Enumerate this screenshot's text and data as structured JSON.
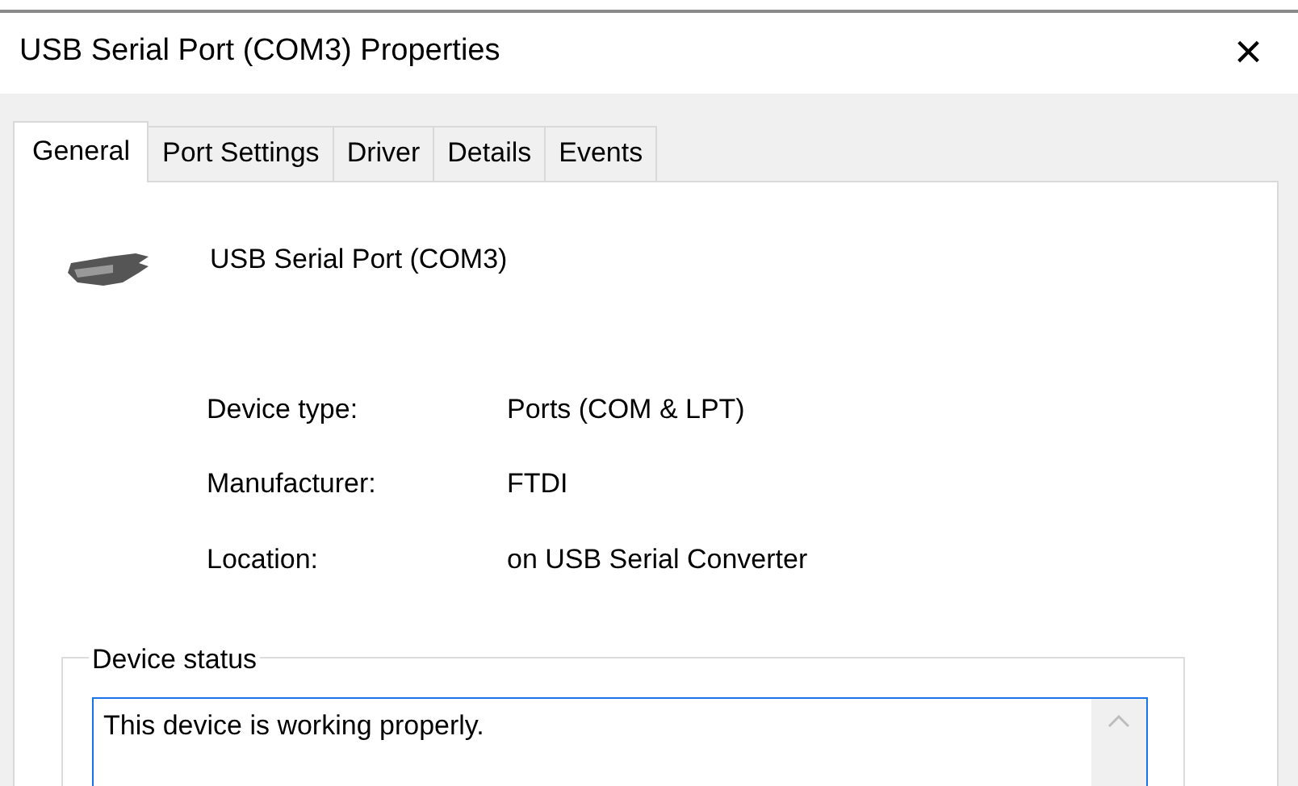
{
  "window": {
    "title": "USB Serial Port (COM3) Properties",
    "close": "×"
  },
  "tabs": [
    {
      "label": "General",
      "selected": true
    },
    {
      "label": "Port Settings",
      "selected": false
    },
    {
      "label": "Driver",
      "selected": false
    },
    {
      "label": "Details",
      "selected": false
    },
    {
      "label": "Events",
      "selected": false
    }
  ],
  "device": {
    "name": "USB Serial Port (COM3)"
  },
  "properties": [
    {
      "label": "Device type:",
      "value": "Ports (COM & LPT)"
    },
    {
      "label": "Manufacturer:",
      "value": "FTDI"
    },
    {
      "label": "Location:",
      "value": "on USB Serial Converter"
    }
  ],
  "device_status": {
    "title": "Device status",
    "value": "This device is working properly."
  }
}
